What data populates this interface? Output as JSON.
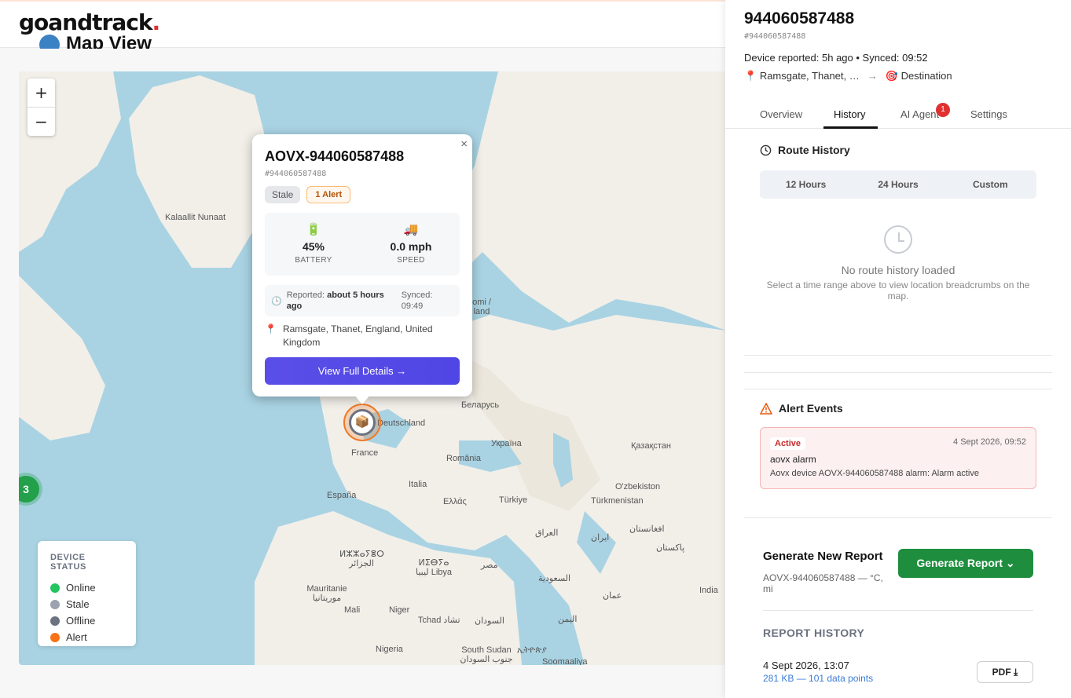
{
  "header": {
    "logo": "goandtrack",
    "logo_dot": ".",
    "page_title": "Map View"
  },
  "map": {
    "zoom_in": "+",
    "zoom_out": "−",
    "cluster_count": "3",
    "places": [
      "Kalaallit Nunaat",
      "Deutschland",
      "Беларусь",
      "Україна",
      "Қазақстан",
      "France",
      "România",
      "Italia",
      "España",
      "Ελλάς",
      "Türkiye",
      "Türkmenistan",
      "O'zbekiston",
      "افغانستان",
      "پاکستان",
      "ایران",
      "العراق",
      "مصر",
      "السعودية",
      "عمان",
      "اليمن",
      "India",
      "ⵍⵣⵣⴰⵢⴻⵔ الجزائر",
      "ⵍⵉⴱⵢⴰ ليبيا Libya",
      "Mauritanie موريتانيا",
      "Mali",
      "Niger",
      "Tchad تشاد",
      "السودان",
      "Nigeria",
      "South Sudan جنوب السودان",
      "ኢትዮጵያ",
      "Soomaaliya",
      "omi / land"
    ]
  },
  "legend": {
    "title": "DEVICE STATUS",
    "items": [
      {
        "label": "Online",
        "color": "#22c55e"
      },
      {
        "label": "Stale",
        "color": "#9ca3af"
      },
      {
        "label": "Offline",
        "color": "#6b7280"
      },
      {
        "label": "Alert",
        "color": "#f97316"
      }
    ]
  },
  "popup": {
    "close": "×",
    "title": "AOVX-944060587488",
    "id": "#944060587488",
    "badge_stale": "Stale",
    "badge_alert": "1 Alert",
    "battery_icon": "🔋",
    "battery_value": "45%",
    "battery_label": "BATTERY",
    "speed_icon": "🚚",
    "speed_value": "0.0 mph",
    "speed_label": "SPEED",
    "reported_label": "Reported:",
    "reported_value": "about 5 hours ago",
    "synced_label": "Synced:",
    "synced_value": "09:49",
    "location": "Ramsgate, Thanet, England, United Kingdom",
    "details_button": "View Full Details →"
  },
  "panel": {
    "title": "944060587488",
    "id": "#944060587488",
    "report_line": "Device reported: 5h ago • Synced: 09:52",
    "origin": "Ramsgate, Thanet, …",
    "arrow": "→",
    "destination": "Destination",
    "tabs": [
      "Overview",
      "History",
      "AI Agent",
      "Settings"
    ],
    "ai_badge": "1",
    "route_history": {
      "title": "Route History",
      "ranges": [
        "12 Hours",
        "24 Hours",
        "Custom"
      ],
      "empty_title": "No route history loaded",
      "empty_sub": "Select a time range above to view location breadcrumbs on the map."
    },
    "alert_events": {
      "title": "Alert Events",
      "status": "Active",
      "time": "4 Sept 2026, 09:52",
      "name": "aovx alarm",
      "description": "Aovx device AOVX-944060587488 alarm: Alarm active"
    },
    "report": {
      "title": "Generate New Report",
      "subtitle": "AOVX-944060587488 — °C, mi",
      "button": "Generate Report",
      "history_title": "REPORT HISTORY",
      "entry_date": "4 Sept 2026, 13:07",
      "entry_meta": "281 KB — 101 data points",
      "pdf_button": "PDF"
    }
  }
}
